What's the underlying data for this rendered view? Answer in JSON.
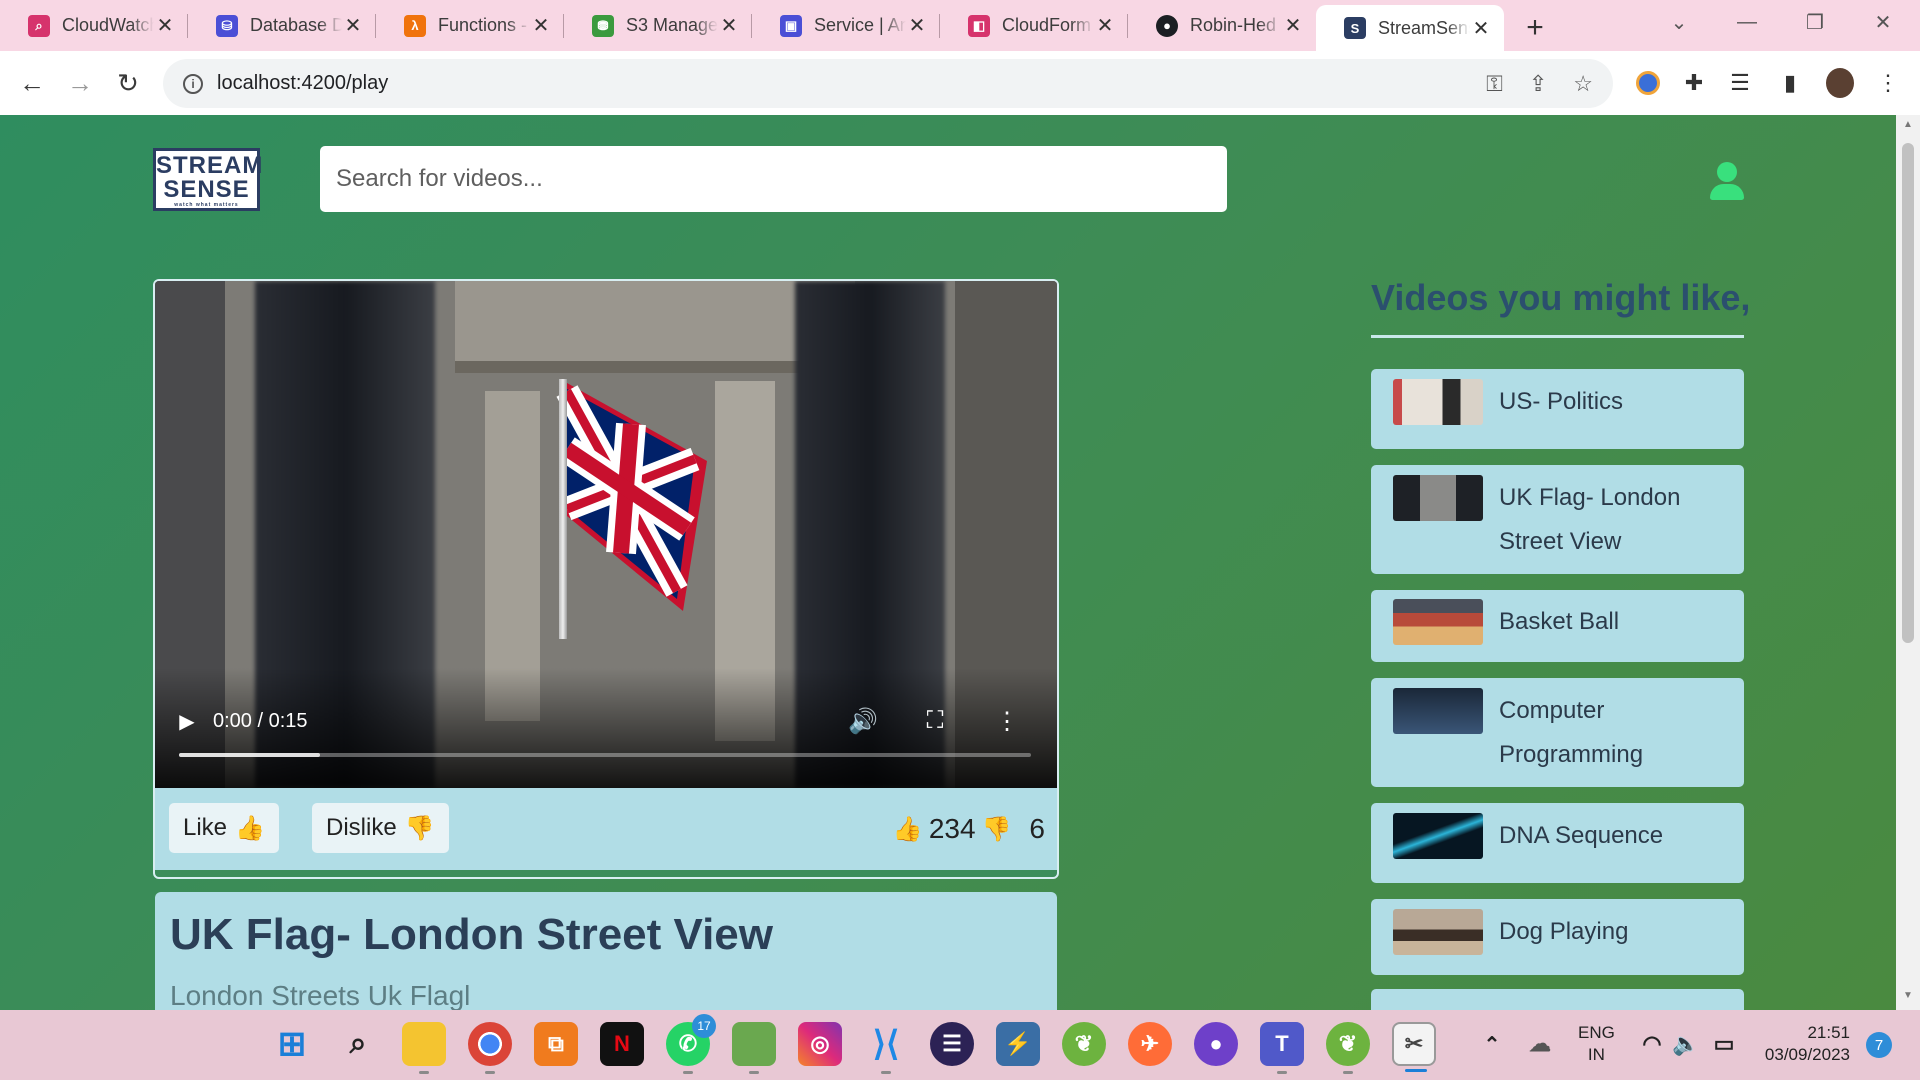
{
  "browser": {
    "tabs": [
      {
        "title": "CloudWatch",
        "color": "#d6336c",
        "glyph": "⌕"
      },
      {
        "title": "Database D",
        "color": "#4b4fd6",
        "glyph": "⛁"
      },
      {
        "title": "Functions -",
        "color": "#f0730c",
        "glyph": "λ"
      },
      {
        "title": "S3 Manage",
        "color": "#3b9a3e",
        "glyph": "⛃"
      },
      {
        "title": "Service | An",
        "color": "#4b4fd6",
        "glyph": "▣"
      },
      {
        "title": "CloudForm",
        "color": "#d6336c",
        "glyph": "◧"
      },
      {
        "title": "Robin-Hed",
        "color": "#1b1f23",
        "glyph": "●"
      },
      {
        "title": "StreamSens",
        "color": "#2b3d62",
        "glyph": "S"
      }
    ],
    "url": "localhost:4200/play"
  },
  "header": {
    "logo_line1": "STREAM",
    "logo_line2": "SENSE",
    "logo_tagline": "watch what matters",
    "search_placeholder": "Search for videos..."
  },
  "player": {
    "time": "0:00 / 0:15",
    "buffered_fraction": 0.165,
    "like_label": "Like",
    "like_emoji": "👍",
    "dislike_label": "Dislike",
    "dislike_emoji": "👎",
    "likes": "234",
    "dislikes": "6"
  },
  "video_info": {
    "title": "UK Flag- London Street View",
    "description": "London Streets Uk Flagl"
  },
  "recommendations": {
    "heading": "Videos you might like,",
    "items": [
      {
        "title": "US- Politics",
        "thumb": "#c9b8a8"
      },
      {
        "title": "UK Flag- London Street View",
        "thumb": "#3d3f45"
      },
      {
        "title": "Basket Ball",
        "thumb": "#9a5848"
      },
      {
        "title": "Computer Programming",
        "thumb": "#2a3b52"
      },
      {
        "title": "DNA Sequence",
        "thumb": "#0e2433"
      },
      {
        "title": "Dog Playing",
        "thumb": "#8d7a66"
      }
    ]
  },
  "taskbar": {
    "whatsapp_badge": "17",
    "lang_line1": "ENG",
    "lang_line2": "IN",
    "time": "21:51",
    "date": "03/09/2023",
    "notifications": "7"
  }
}
